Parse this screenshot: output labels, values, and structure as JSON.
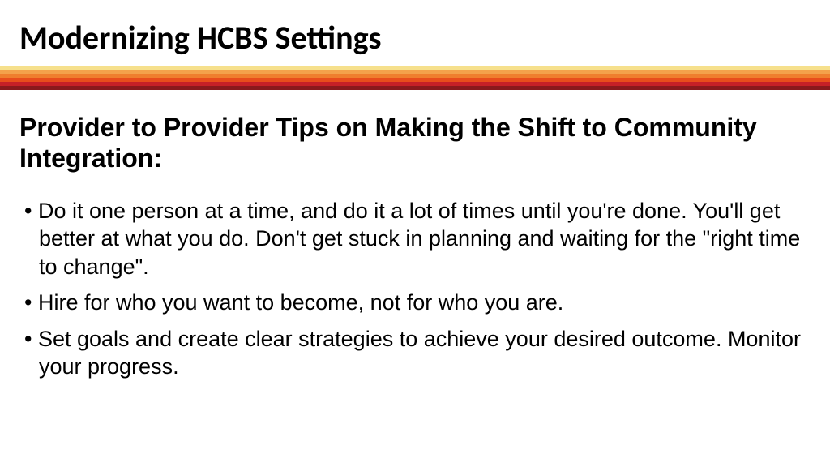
{
  "title": "Modernizing HCBS Settings",
  "subtitle": "Provider to Provider Tips on Making the Shift to Community Integration:",
  "bullets": [
    "Do it one person at a time, and do it a lot of times until you're done.  You'll get better at what you do.  Don't get stuck in planning and waiting for the \"right time to change\".",
    "Hire for who you want to become, not for who you are.",
    "Set goals and create clear strategies to achieve your desired outcome.  Monitor your progress."
  ],
  "bar_colors": [
    "#f6e08c",
    "#f4a24b",
    "#ef7f2e",
    "#e84e1c",
    "#c62127",
    "#8a1a1c"
  ]
}
